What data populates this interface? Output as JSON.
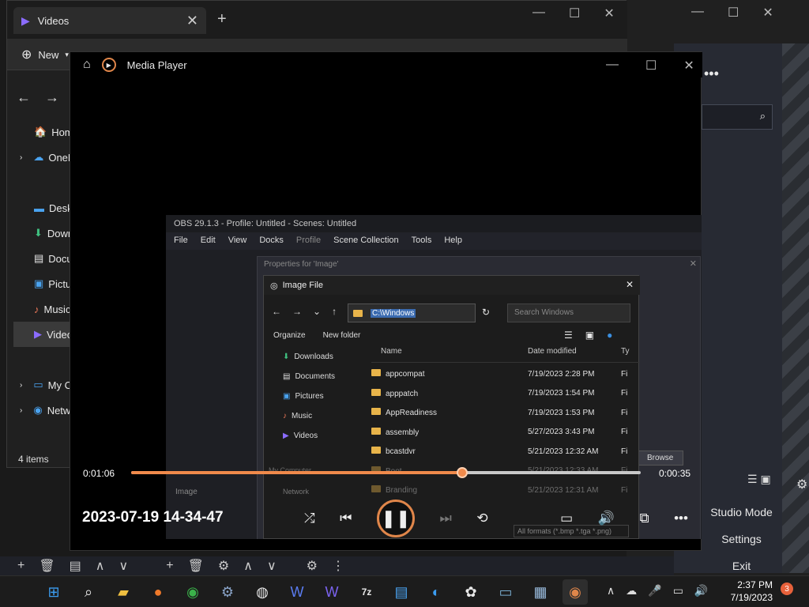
{
  "explorer": {
    "tab_title": "Videos",
    "new_label": "New",
    "sidebar": [
      "Home",
      "OneDrive",
      "Desktop",
      "Downloads",
      "Documents",
      "Pictures",
      "Music",
      "Videos",
      "My Computer",
      "Network"
    ],
    "status": "4 items"
  },
  "media_player": {
    "title": "Media Player",
    "current_time": "0:01:06",
    "remaining_time": "0:00:35",
    "progress_fraction": 0.65,
    "media_name": "2023-07-19 14-34-47"
  },
  "video_frame": {
    "obs_title": "OBS 29.1.3 - Profile: Untitled - Scenes: Untitled",
    "menu": [
      "File",
      "Edit",
      "View",
      "Docks",
      "Profile",
      "Scene Collection",
      "Tools",
      "Help"
    ],
    "properties_title": "Properties for 'Image'",
    "dialog_title": "Image File",
    "address": "C:\\Windows",
    "search_placeholder": "Search Windows",
    "organize": "Organize",
    "new_folder": "New folder",
    "quick_access": [
      "Downloads",
      "Documents",
      "Pictures",
      "Music",
      "Videos"
    ],
    "col_name": "Name",
    "col_date": "Date modified",
    "col_type": "Ty",
    "rows": [
      {
        "name": "appcompat",
        "date": "7/19/2023 2:28 PM",
        "type": "Fi"
      },
      {
        "name": "apppatch",
        "date": "7/19/2023 1:54 PM",
        "type": "Fi"
      },
      {
        "name": "AppReadiness",
        "date": "7/19/2023 1:53 PM",
        "type": "Fi"
      },
      {
        "name": "assembly",
        "date": "5/27/2023 3:43 PM",
        "type": "Fi"
      },
      {
        "name": "bcastdvr",
        "date": "5/21/2023 12:32 AM",
        "type": "Fi"
      },
      {
        "name": "Boot",
        "date": "5/21/2023 12:33 AM",
        "type": "Fi"
      },
      {
        "name": "Branding",
        "date": "5/21/2023 12:31 AM",
        "type": "Fi"
      }
    ],
    "browse": "Browse",
    "image_label": "Image",
    "network_label": "Network",
    "my_computer_label": "My Computer",
    "file_filter": "All formats (*.bmp *.tga *.png)"
  },
  "obs_right": {
    "studio_mode": "Studio Mode",
    "settings": "Settings",
    "exit": "Exit"
  },
  "taskbar": {
    "time": "2:37 PM",
    "date": "7/19/2023",
    "notifications": "3"
  }
}
